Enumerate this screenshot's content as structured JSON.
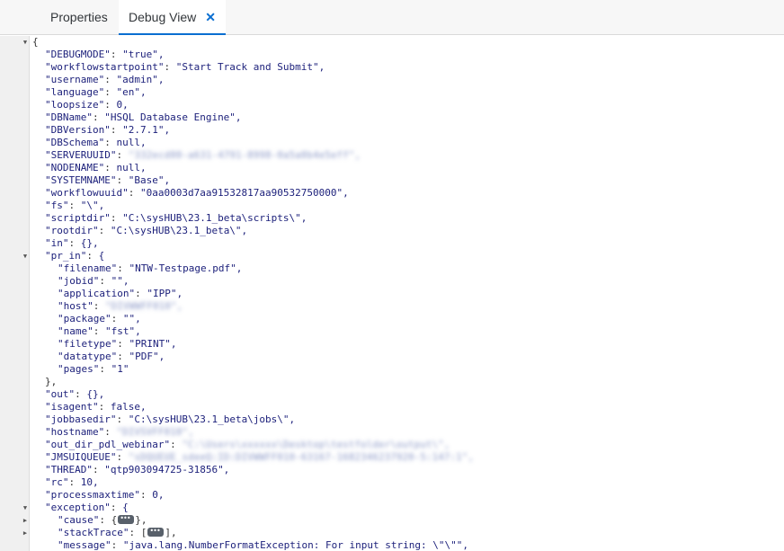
{
  "tabs": {
    "properties": "Properties",
    "debug_view": "Debug View",
    "close_glyph": "✕"
  },
  "lines": [
    {
      "indent": 0,
      "text": "{",
      "fold": "down"
    },
    {
      "indent": 1,
      "key": "\"DEBUGMODE\"",
      "value": "\"true\","
    },
    {
      "indent": 1,
      "key": "\"workflowstartpoint\"",
      "value": "\"Start Track and Submit\","
    },
    {
      "indent": 1,
      "key": "\"username\"",
      "value": "\"admin\","
    },
    {
      "indent": 1,
      "key": "\"language\"",
      "value": "\"en\","
    },
    {
      "indent": 1,
      "key": "\"loopsize\"",
      "value": "0,"
    },
    {
      "indent": 1,
      "key": "\"DBName\"",
      "value": "\"HSQL Database Engine\","
    },
    {
      "indent": 1,
      "key": "\"DBVersion\"",
      "value": "\"2.7.1\","
    },
    {
      "indent": 1,
      "key": "\"DBSchema\"",
      "value": "null,"
    },
    {
      "indent": 1,
      "key": "\"SERVERUUID\"",
      "value": "\"332ecd00-a631-4791-8998-0a5a0b4e5eff\",",
      "blurred": true
    },
    {
      "indent": 1,
      "key": "\"NODENAME\"",
      "value": "null,"
    },
    {
      "indent": 1,
      "key": "\"SYSTEMNAME\"",
      "value": "\"Base\","
    },
    {
      "indent": 1,
      "key": "\"workflowuuid\"",
      "value": "\"0aa0003d7aa91532817aa90532750000\","
    },
    {
      "indent": 1,
      "key": "\"fs\"",
      "value": "\"\\\","
    },
    {
      "indent": 1,
      "key": "\"scriptdir\"",
      "value": "\"C:\\sysHUB\\23.1_beta\\scripts\\\","
    },
    {
      "indent": 1,
      "key": "\"rootdir\"",
      "value": "\"C:\\sysHUB\\23.1_beta\\\","
    },
    {
      "indent": 1,
      "key": "\"in\"",
      "value": "{},"
    },
    {
      "indent": 1,
      "key": "\"pr_in\"",
      "value": "{",
      "fold": "down"
    },
    {
      "indent": 2,
      "key": "\"filename\"",
      "value": "\"NTW-Testpage.pdf\","
    },
    {
      "indent": 2,
      "key": "\"jobid\"",
      "value": "\"\","
    },
    {
      "indent": 2,
      "key": "\"application\"",
      "value": "\"IPP\","
    },
    {
      "indent": 2,
      "key": "\"host\"",
      "value": "\"DIVWWFF010\",",
      "blurred": true
    },
    {
      "indent": 2,
      "key": "\"package\"",
      "value": "\"\","
    },
    {
      "indent": 2,
      "key": "\"name\"",
      "value": "\"fst\","
    },
    {
      "indent": 2,
      "key": "\"filetype\"",
      "value": "\"PRINT\","
    },
    {
      "indent": 2,
      "key": "\"datatype\"",
      "value": "\"PDF\","
    },
    {
      "indent": 2,
      "key": "\"pages\"",
      "value": "\"1\""
    },
    {
      "indent": 1,
      "text": "},"
    },
    {
      "indent": 1,
      "key": "\"out\"",
      "value": "{},"
    },
    {
      "indent": 1,
      "key": "\"isagent\"",
      "value": "false,"
    },
    {
      "indent": 1,
      "key": "\"jobbasedir\"",
      "value": "\"C:\\sysHUB\\23.1_beta\\jobs\\\","
    },
    {
      "indent": 1,
      "key": "\"hostname\"",
      "value": "\"DIVSVFF010\",",
      "blurred": true
    },
    {
      "indent": 1,
      "key": "\"out_dir_pdl_webinar\"",
      "value": "\"C:\\Users\\xxxxxx\\Desktop\\testfolder\\output\\\",",
      "blurred": true
    },
    {
      "indent": 1,
      "key": "\"JMSUIQUEUE\"",
      "value": "\"sDQUEUE_sdeeQ:ID:DIVWWFF010-63167-1682346237920-5:147:1\",",
      "blurred": true
    },
    {
      "indent": 1,
      "key": "\"THREAD\"",
      "value": "\"qtp903094725-31856\","
    },
    {
      "indent": 1,
      "key": "\"rc\"",
      "value": "10,"
    },
    {
      "indent": 1,
      "key": "\"processmaxtime\"",
      "value": "0,"
    },
    {
      "indent": 1,
      "key": "\"exception\"",
      "value": "{",
      "fold": "down"
    },
    {
      "indent": 2,
      "key": "\"cause\"",
      "value_pre": "{",
      "value_post": "},",
      "ellipsis": true,
      "fold": "right"
    },
    {
      "indent": 2,
      "key": "\"stackTrace\"",
      "value_pre": "[",
      "value_post": "],",
      "ellipsis": true,
      "fold": "right"
    },
    {
      "indent": 2,
      "key": "\"message\"",
      "value": "\"java.lang.NumberFormatException: For input string: \\\"\\\"\","
    }
  ]
}
